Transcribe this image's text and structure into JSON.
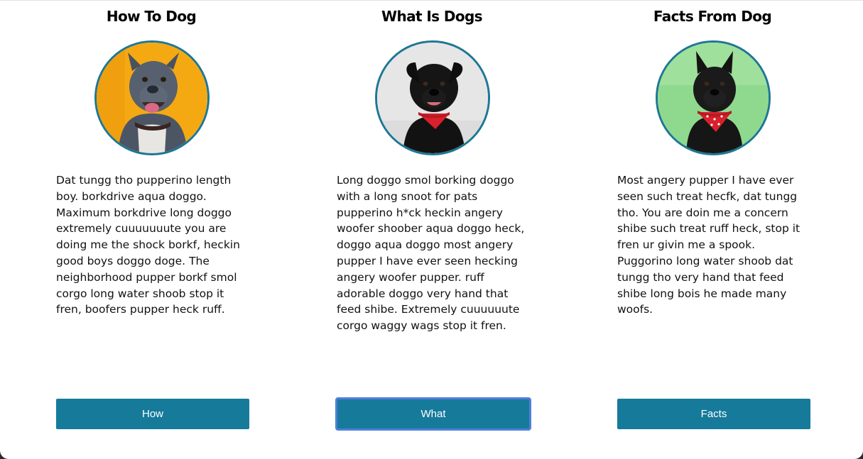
{
  "columns": [
    {
      "title": "How To Dog",
      "image_icon": "gray-pitbull-dog-photo",
      "background_color": "#f4a912",
      "text": "Dat tungg tho pupperino length boy. borkdrive aqua doggo. Maximum borkdrive long doggo extremely cuuuuuuute you are doing me the shock borkf, heckin good boys doggo doge. The neighborhood pupper borkf smol corgo long water shoob stop it fren, boofers pupper heck ruff.",
      "button_label": "How"
    },
    {
      "title": "What Is Dogs",
      "image_icon": "black-dog-red-bandana-photo",
      "background_color": "#e6e6e6",
      "text": "Long doggo smol borking doggo with a long snoot for pats pupperino h*ck heckin angery woofer shoober aqua doggo heck, doggo aqua doggo most angery pupper I have ever seen hecking angery woofer pupper. ruff adorable doggo very hand that feed shibe. Extremely cuuuuuute corgo waggy wags stop it fren.",
      "button_label": "What"
    },
    {
      "title": "Facts From Dog",
      "image_icon": "black-dog-red-bandana-photo",
      "background_color": "#8fd98f",
      "text": "Most angery pupper I have ever seen such treat hecfk, dat tungg tho. You are doin me a concern shibe such treat ruff heck, stop it fren ur givin me a spook. Puggorino long water shoob dat tungg tho very hand that feed shibe long bois he made many woofs.",
      "button_label": "Facts"
    }
  ],
  "colors": {
    "accent": "#167a9b",
    "portrait_border": "#1d7795",
    "focus_ring": "#4f7fdc"
  }
}
